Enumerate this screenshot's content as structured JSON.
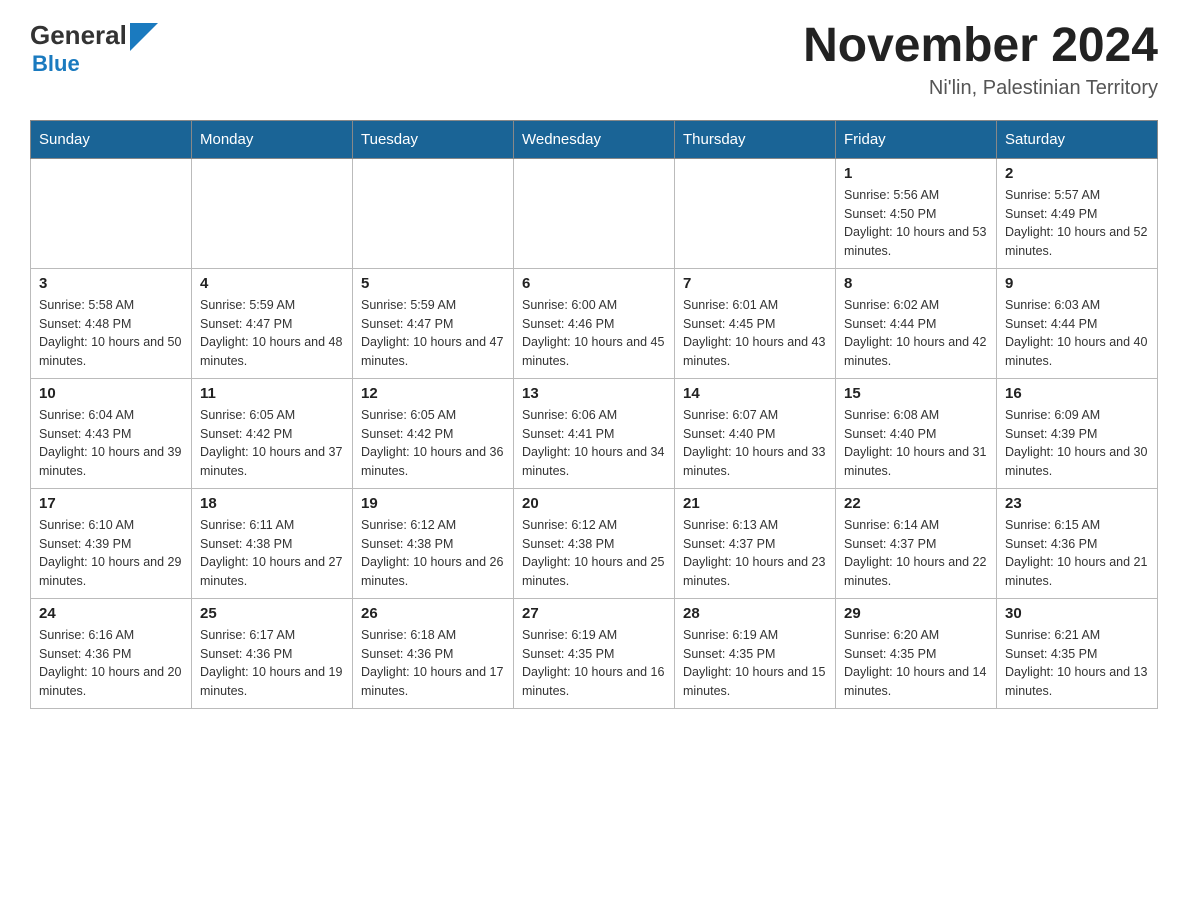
{
  "header": {
    "logo_general": "General",
    "logo_blue": "Blue",
    "month_year": "November 2024",
    "location": "Ni'lin, Palestinian Territory"
  },
  "days_of_week": [
    "Sunday",
    "Monday",
    "Tuesday",
    "Wednesday",
    "Thursday",
    "Friday",
    "Saturday"
  ],
  "weeks": [
    {
      "days": [
        {
          "number": "",
          "info": ""
        },
        {
          "number": "",
          "info": ""
        },
        {
          "number": "",
          "info": ""
        },
        {
          "number": "",
          "info": ""
        },
        {
          "number": "",
          "info": ""
        },
        {
          "number": "1",
          "info": "Sunrise: 5:56 AM\nSunset: 4:50 PM\nDaylight: 10 hours and 53 minutes."
        },
        {
          "number": "2",
          "info": "Sunrise: 5:57 AM\nSunset: 4:49 PM\nDaylight: 10 hours and 52 minutes."
        }
      ]
    },
    {
      "days": [
        {
          "number": "3",
          "info": "Sunrise: 5:58 AM\nSunset: 4:48 PM\nDaylight: 10 hours and 50 minutes."
        },
        {
          "number": "4",
          "info": "Sunrise: 5:59 AM\nSunset: 4:47 PM\nDaylight: 10 hours and 48 minutes."
        },
        {
          "number": "5",
          "info": "Sunrise: 5:59 AM\nSunset: 4:47 PM\nDaylight: 10 hours and 47 minutes."
        },
        {
          "number": "6",
          "info": "Sunrise: 6:00 AM\nSunset: 4:46 PM\nDaylight: 10 hours and 45 minutes."
        },
        {
          "number": "7",
          "info": "Sunrise: 6:01 AM\nSunset: 4:45 PM\nDaylight: 10 hours and 43 minutes."
        },
        {
          "number": "8",
          "info": "Sunrise: 6:02 AM\nSunset: 4:44 PM\nDaylight: 10 hours and 42 minutes."
        },
        {
          "number": "9",
          "info": "Sunrise: 6:03 AM\nSunset: 4:44 PM\nDaylight: 10 hours and 40 minutes."
        }
      ]
    },
    {
      "days": [
        {
          "number": "10",
          "info": "Sunrise: 6:04 AM\nSunset: 4:43 PM\nDaylight: 10 hours and 39 minutes."
        },
        {
          "number": "11",
          "info": "Sunrise: 6:05 AM\nSunset: 4:42 PM\nDaylight: 10 hours and 37 minutes."
        },
        {
          "number": "12",
          "info": "Sunrise: 6:05 AM\nSunset: 4:42 PM\nDaylight: 10 hours and 36 minutes."
        },
        {
          "number": "13",
          "info": "Sunrise: 6:06 AM\nSunset: 4:41 PM\nDaylight: 10 hours and 34 minutes."
        },
        {
          "number": "14",
          "info": "Sunrise: 6:07 AM\nSunset: 4:40 PM\nDaylight: 10 hours and 33 minutes."
        },
        {
          "number": "15",
          "info": "Sunrise: 6:08 AM\nSunset: 4:40 PM\nDaylight: 10 hours and 31 minutes."
        },
        {
          "number": "16",
          "info": "Sunrise: 6:09 AM\nSunset: 4:39 PM\nDaylight: 10 hours and 30 minutes."
        }
      ]
    },
    {
      "days": [
        {
          "number": "17",
          "info": "Sunrise: 6:10 AM\nSunset: 4:39 PM\nDaylight: 10 hours and 29 minutes."
        },
        {
          "number": "18",
          "info": "Sunrise: 6:11 AM\nSunset: 4:38 PM\nDaylight: 10 hours and 27 minutes."
        },
        {
          "number": "19",
          "info": "Sunrise: 6:12 AM\nSunset: 4:38 PM\nDaylight: 10 hours and 26 minutes."
        },
        {
          "number": "20",
          "info": "Sunrise: 6:12 AM\nSunset: 4:38 PM\nDaylight: 10 hours and 25 minutes."
        },
        {
          "number": "21",
          "info": "Sunrise: 6:13 AM\nSunset: 4:37 PM\nDaylight: 10 hours and 23 minutes."
        },
        {
          "number": "22",
          "info": "Sunrise: 6:14 AM\nSunset: 4:37 PM\nDaylight: 10 hours and 22 minutes."
        },
        {
          "number": "23",
          "info": "Sunrise: 6:15 AM\nSunset: 4:36 PM\nDaylight: 10 hours and 21 minutes."
        }
      ]
    },
    {
      "days": [
        {
          "number": "24",
          "info": "Sunrise: 6:16 AM\nSunset: 4:36 PM\nDaylight: 10 hours and 20 minutes."
        },
        {
          "number": "25",
          "info": "Sunrise: 6:17 AM\nSunset: 4:36 PM\nDaylight: 10 hours and 19 minutes."
        },
        {
          "number": "26",
          "info": "Sunrise: 6:18 AM\nSunset: 4:36 PM\nDaylight: 10 hours and 17 minutes."
        },
        {
          "number": "27",
          "info": "Sunrise: 6:19 AM\nSunset: 4:35 PM\nDaylight: 10 hours and 16 minutes."
        },
        {
          "number": "28",
          "info": "Sunrise: 6:19 AM\nSunset: 4:35 PM\nDaylight: 10 hours and 15 minutes."
        },
        {
          "number": "29",
          "info": "Sunrise: 6:20 AM\nSunset: 4:35 PM\nDaylight: 10 hours and 14 minutes."
        },
        {
          "number": "30",
          "info": "Sunrise: 6:21 AM\nSunset: 4:35 PM\nDaylight: 10 hours and 13 minutes."
        }
      ]
    }
  ]
}
